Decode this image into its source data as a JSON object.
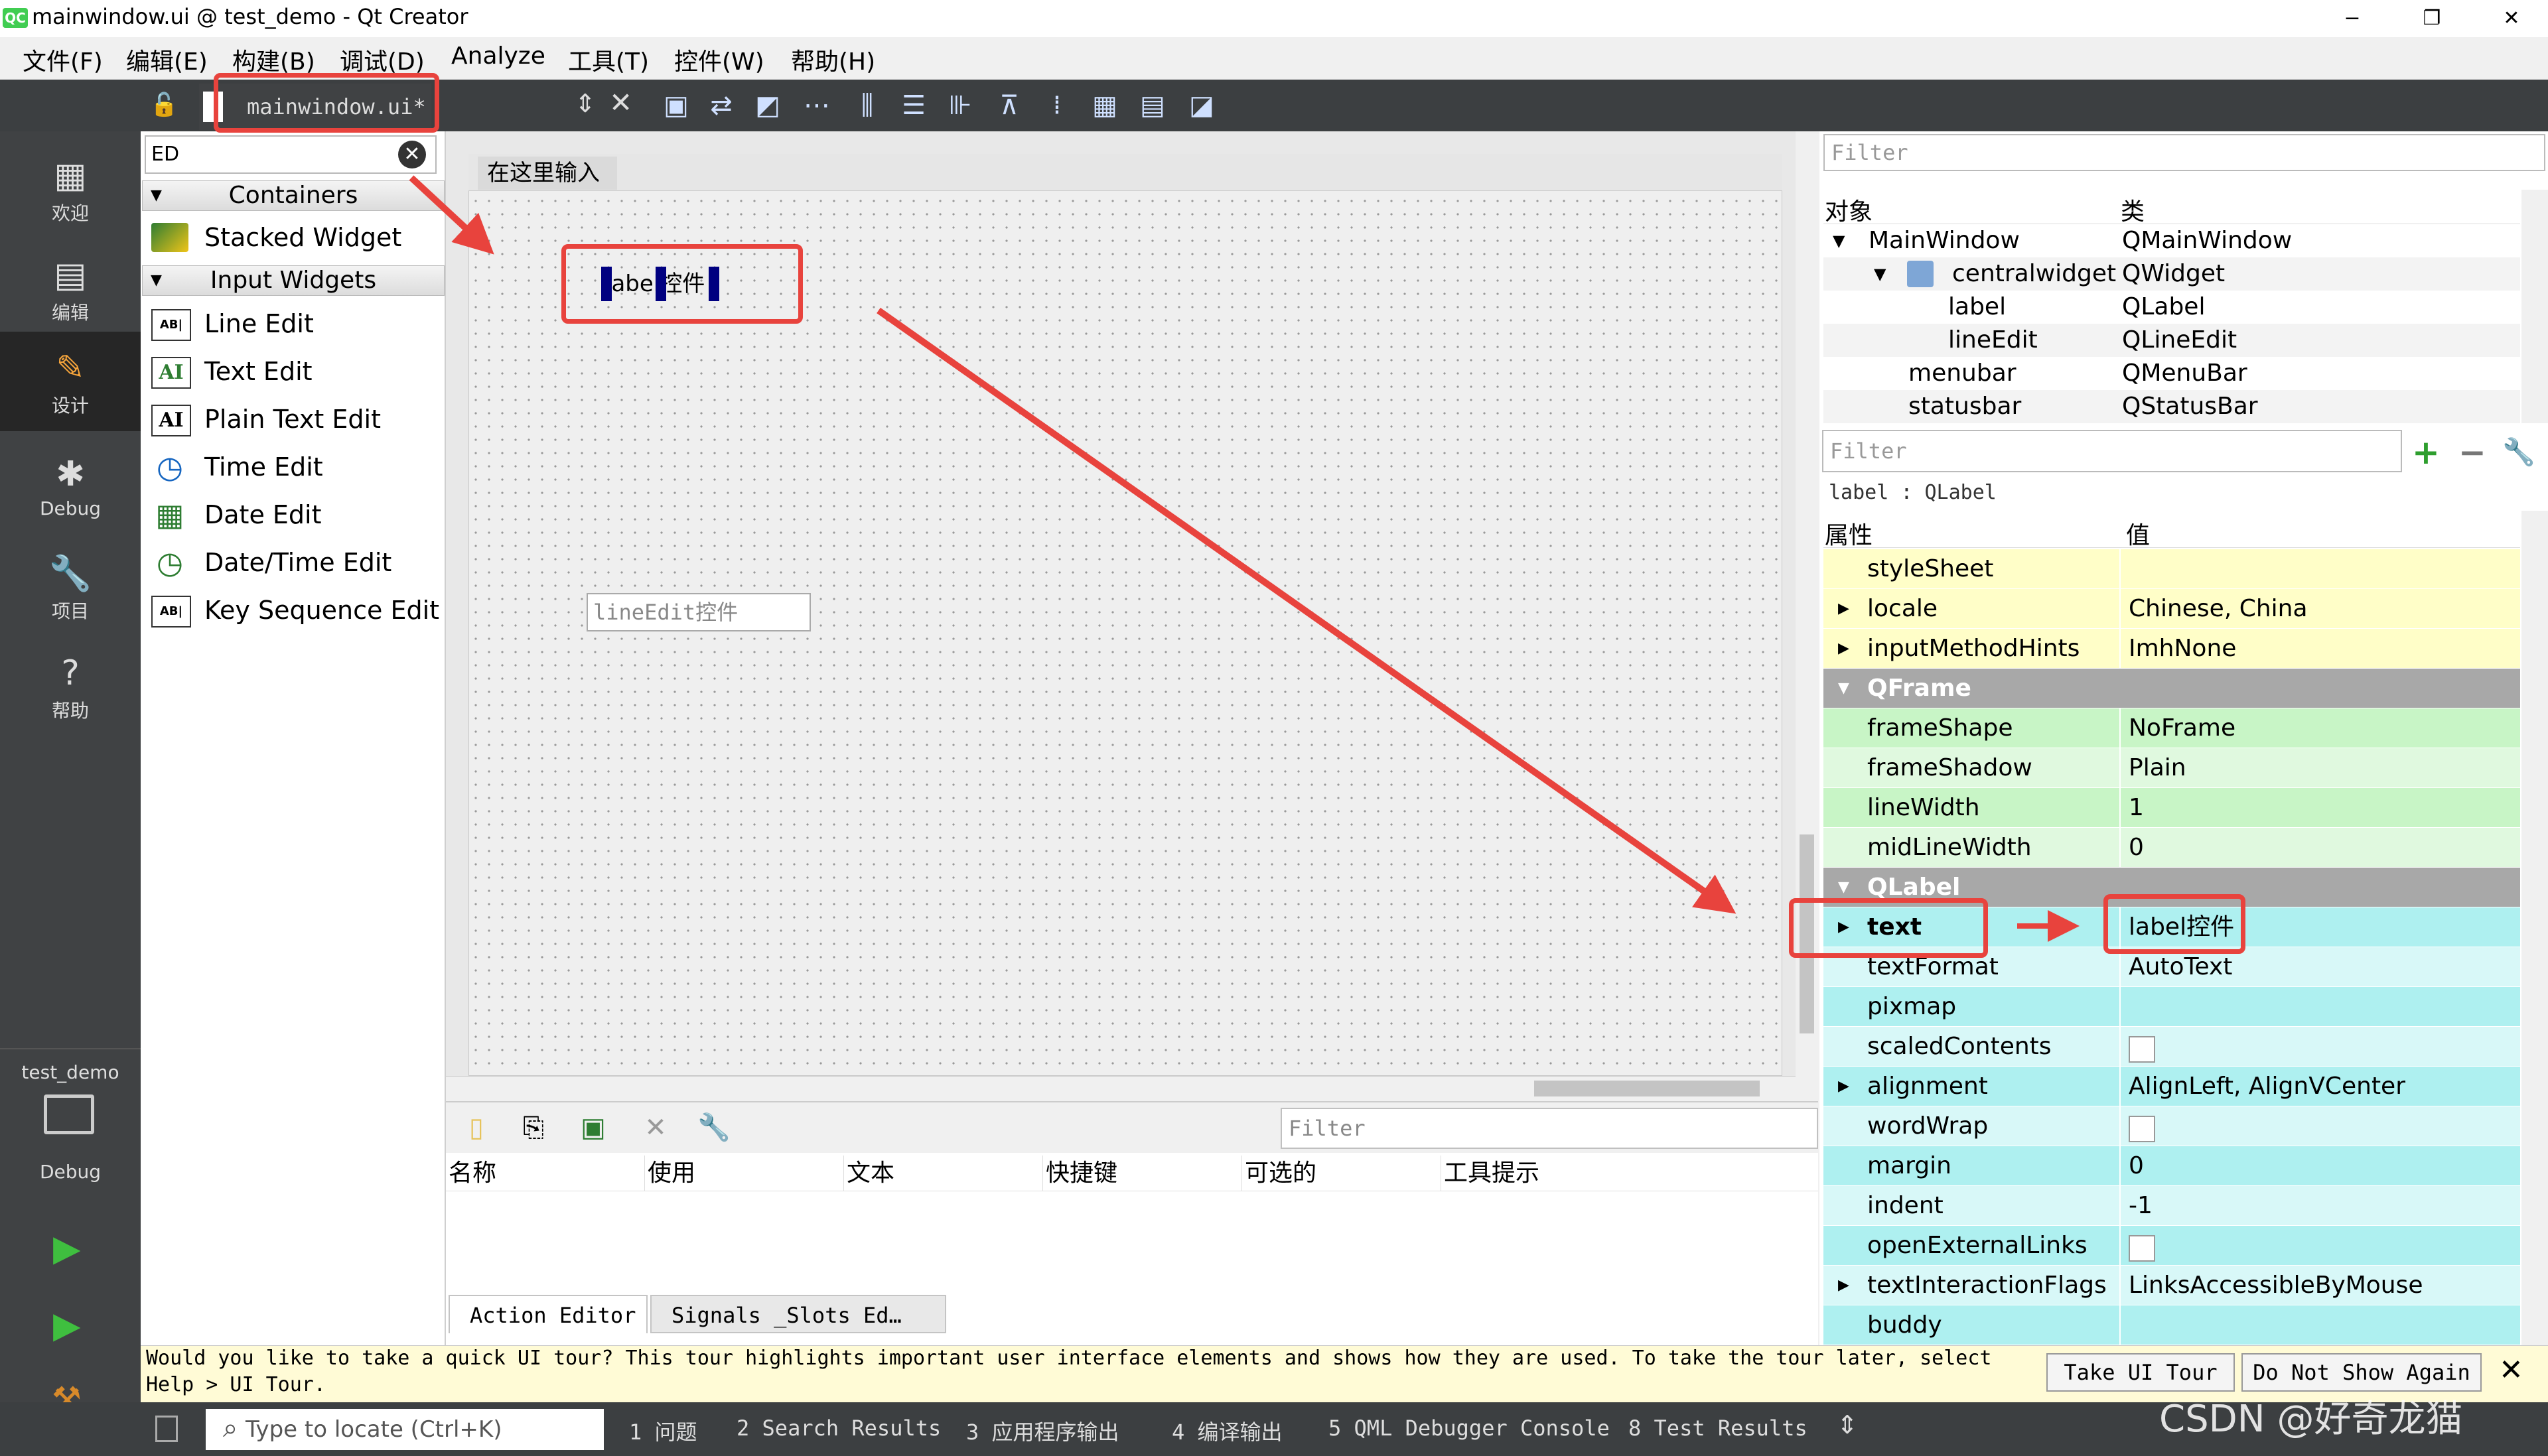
{
  "window": {
    "title": "mainwindow.ui @ test_demo - Qt Creator",
    "app_icon_text": "QC",
    "minimize": "−",
    "maximize": "❐",
    "close": "✕"
  },
  "menubar": [
    "文件(F)",
    "编辑(E)",
    "构建(B)",
    "调试(D)",
    "Analyze",
    "工具(T)",
    "控件(W)",
    "帮助(H)"
  ],
  "editor_tab": {
    "name": "mainwindow.ui*"
  },
  "modes": [
    {
      "label": "欢迎",
      "icon": "grid-icon",
      "glyph": "▦"
    },
    {
      "label": "编辑",
      "icon": "edit-icon",
      "glyph": "▤"
    },
    {
      "label": "设计",
      "icon": "design-icon",
      "glyph": "✎"
    },
    {
      "label": "Debug",
      "icon": "bug-icon",
      "glyph": "✱"
    },
    {
      "label": "项目",
      "icon": "wrench-icon",
      "glyph": "🔧"
    },
    {
      "label": "帮助",
      "icon": "help-icon",
      "glyph": "?"
    }
  ],
  "kit": {
    "project": "test_demo",
    "build": "Debug"
  },
  "widget_box": {
    "filter": "ED",
    "categories": [
      {
        "name": "Containers",
        "items": [
          {
            "label": "Stacked Widget",
            "icon": "stacked-widget-icon"
          }
        ]
      },
      {
        "name": "Input Widgets",
        "items": [
          {
            "label": "Line Edit",
            "icon": "line-edit-icon",
            "glyph": "AB|"
          },
          {
            "label": "Text Edit",
            "icon": "text-edit-icon",
            "glyph": "AI"
          },
          {
            "label": "Plain Text Edit",
            "icon": "plain-text-edit-icon",
            "glyph": "AI"
          },
          {
            "label": "Time Edit",
            "icon": "clock-icon",
            "glyph": "◷"
          },
          {
            "label": "Date Edit",
            "icon": "calendar-icon",
            "glyph": "▦"
          },
          {
            "label": "Date/Time Edit",
            "icon": "calendar-clock-icon",
            "glyph": "◷"
          },
          {
            "label": "Key Sequence Edit",
            "icon": "key-sequence-icon",
            "glyph": "AB|"
          }
        ]
      }
    ]
  },
  "form": {
    "menu_placeholder": "在这里输入",
    "label_text": "label控件",
    "lineedit_text": "lineEdit控件"
  },
  "action_editor": {
    "filter_placeholder": "Filter",
    "columns": [
      "名称",
      "使用",
      "文本",
      "快捷键",
      "可选的",
      "工具提示"
    ],
    "tabs": [
      "Action Editor",
      "Signals _Slots Ed…"
    ]
  },
  "object_inspector": {
    "filter_placeholder": "Filter",
    "headers": [
      "对象",
      "类"
    ],
    "rows": [
      {
        "object": "MainWindow",
        "class": "QMainWindow"
      },
      {
        "object": "centralwidget",
        "class": "QWidget"
      },
      {
        "object": "label",
        "class": "QLabel"
      },
      {
        "object": "lineEdit",
        "class": "QLineEdit"
      },
      {
        "object": "menubar",
        "class": "QMenuBar"
      },
      {
        "object": "statusbar",
        "class": "QStatusBar"
      }
    ]
  },
  "property_editor": {
    "filter_placeholder": "Filter",
    "class_line": "label : QLabel",
    "headers": [
      "属性",
      "值"
    ],
    "rows": [
      {
        "name": "styleSheet",
        "value": ""
      },
      {
        "name": "locale",
        "value": "Chinese, China"
      },
      {
        "name": "inputMethodHints",
        "value": "ImhNone"
      },
      {
        "name": "QFrame",
        "value": ""
      },
      {
        "name": "frameShape",
        "value": "NoFrame"
      },
      {
        "name": "frameShadow",
        "value": "Plain"
      },
      {
        "name": "lineWidth",
        "value": "1"
      },
      {
        "name": "midLineWidth",
        "value": "0"
      },
      {
        "name": "QLabel",
        "value": ""
      },
      {
        "name": "text",
        "value": "label控件"
      },
      {
        "name": "textFormat",
        "value": "AutoText"
      },
      {
        "name": "pixmap",
        "value": ""
      },
      {
        "name": "scaledContents",
        "value": ""
      },
      {
        "name": "alignment",
        "value": "AlignLeft, AlignVCenter"
      },
      {
        "name": "wordWrap",
        "value": ""
      },
      {
        "name": "margin",
        "value": "0"
      },
      {
        "name": "indent",
        "value": "-1"
      },
      {
        "name": "openExternalLinks",
        "value": ""
      },
      {
        "name": "textInteractionFlags",
        "value": "LinksAccessibleByMouse"
      },
      {
        "name": "buddy",
        "value": ""
      }
    ]
  },
  "tour": {
    "line1": "Would you like to take a quick UI tour? This tour highlights important user interface elements and shows how they are used. To take the tour later, select",
    "line2": "Help > UI Tour.",
    "take_tour": "Take UI Tour",
    "dont_show": "Do Not Show Again"
  },
  "statusbar": {
    "locator_placeholder": "Type to locate (Ctrl+K)",
    "panes": [
      "1 问题",
      "2 Search Results",
      "3 应用程序输出",
      "4 编译输出",
      "5 QML Debugger Console",
      "8 Test Results"
    ]
  },
  "watermark": "CSDN @好奇龙猫"
}
